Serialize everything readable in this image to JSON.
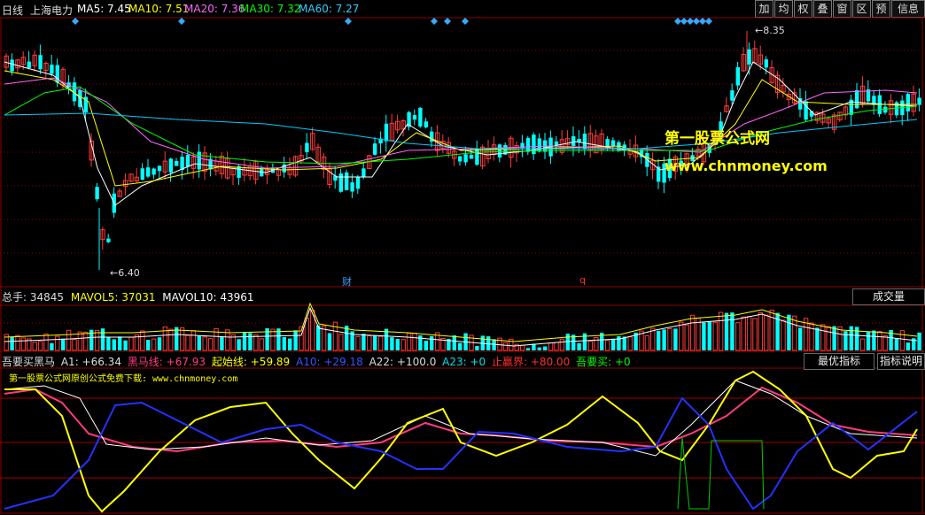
{
  "header": {
    "period": "日线",
    "stock": "上海电力",
    "ma5": "MA5: 7.45",
    "ma10": "MA10: 7.51",
    "ma20": "MA20: 7.36",
    "ma30": "MA30: 7.32",
    "ma60": "MA60: 7.27"
  },
  "toolbar": [
    "加",
    "均",
    "权",
    "叠",
    "窗",
    "区",
    "预",
    "信息"
  ],
  "price_panel": {
    "high_label": "8.35",
    "low_label": "6.40",
    "event_cai": "财",
    "event_q": "q",
    "watermark_title": "第一股票公式网",
    "watermark_url": "www.chnmoney.com"
  },
  "volume_panel": {
    "total": "总手: 34845",
    "mavol5": "MAVOL5: 37031",
    "mavol10": "MAVOL10: 43961",
    "button": "成交量"
  },
  "indicator_panel": {
    "name": "吾要买黑马",
    "a1": "A1: +66.34",
    "heima": "黑马线: +67.93",
    "qishi": "起始线: +59.89",
    "a10": "A10: +29.18",
    "a22": "A22: +100.0",
    "a23": "A23: +0",
    "zhiying": "止赢界: +80.00",
    "woyaomai": "吾要买: +0",
    "btn_best": "最优指标",
    "btn_help": "指标说明",
    "subtitle": "第一股票公式网原创公式免费下载: www.chnmoney.com"
  },
  "colors": {
    "ma5": "#ffffff",
    "ma10": "#ffff00",
    "ma20": "#ff66ff",
    "ma30": "#00ff00",
    "ma60": "#00ccff",
    "up": "#ff3c3c",
    "down": "#00ffff",
    "grid": "#8b0000"
  }
}
